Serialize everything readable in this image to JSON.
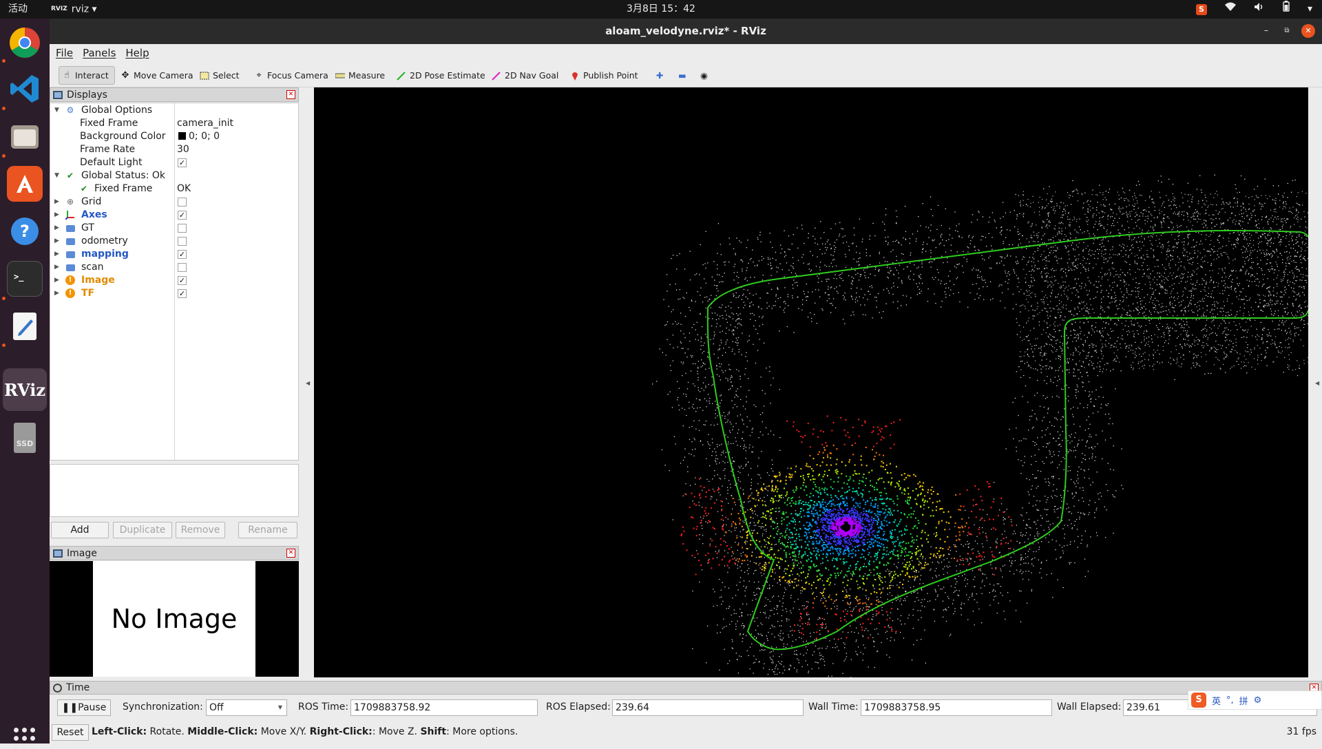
{
  "topbar": {
    "activities": "活动",
    "app_name": "rviz",
    "app_logo": "RVIZ",
    "clock": "3月8日  15：42"
  },
  "window": {
    "title": "aloam_velodyne.rviz* - RViz"
  },
  "menu": [
    "File",
    "Panels",
    "Help"
  ],
  "toolbar": [
    {
      "label": "Interact",
      "icon": "cursor-icon",
      "active": true
    },
    {
      "label": "Move Camera",
      "icon": "move-icon"
    },
    {
      "label": "Select",
      "icon": "select-box-icon"
    },
    {
      "label": "Focus Camera",
      "icon": "crosshair-icon"
    },
    {
      "label": "Measure",
      "icon": "ruler-icon"
    },
    {
      "label": "2D Pose Estimate",
      "icon": "green-arrow-icon"
    },
    {
      "label": "2D Nav Goal",
      "icon": "magenta-arrow-icon"
    },
    {
      "label": "Publish Point",
      "icon": "pin-icon"
    }
  ],
  "displays": {
    "title": "Displays",
    "global_options": "Global Options",
    "fixed_frame_label": "Fixed Frame",
    "fixed_frame_value": "camera_init",
    "bg_color_label": "Background Color",
    "bg_color_value": "0; 0; 0",
    "bg_color_swatch": "#000000",
    "frame_rate_label": "Frame Rate",
    "frame_rate_value": "30",
    "default_light_label": "Default Light",
    "global_status": "Global Status: Ok",
    "status_fixed_frame": "Fixed Frame",
    "status_fixed_frame_value": "OK",
    "items": [
      {
        "name": "Grid",
        "checked": false,
        "style": "normal",
        "icon": "grid-icon"
      },
      {
        "name": "Axes",
        "checked": true,
        "style": "blue",
        "icon": "axes-icon"
      },
      {
        "name": "GT",
        "checked": false,
        "style": "normal",
        "icon": "folder-icon"
      },
      {
        "name": "odometry",
        "checked": false,
        "style": "normal",
        "icon": "folder-icon"
      },
      {
        "name": "mapping",
        "checked": true,
        "style": "blue",
        "icon": "folder-icon"
      },
      {
        "name": "scan",
        "checked": false,
        "style": "normal",
        "icon": "folder-icon"
      },
      {
        "name": "Image",
        "checked": true,
        "style": "orange",
        "icon": "warning-icon"
      },
      {
        "name": "TF",
        "checked": true,
        "style": "orange",
        "icon": "warning-icon"
      }
    ],
    "buttons": {
      "add": "Add",
      "duplicate": "Duplicate",
      "remove": "Remove",
      "rename": "Rename"
    }
  },
  "image_panel": {
    "title": "Image",
    "placeholder": "No Image"
  },
  "time": {
    "title": "Time",
    "pause": "Pause",
    "sync_label": "Synchronization:",
    "sync_value": "Off",
    "ros_time_label": "ROS Time:",
    "ros_time": "1709883758.92",
    "ros_elapsed_label": "ROS Elapsed:",
    "ros_elapsed": "239.64",
    "wall_time_label": "Wall Time:",
    "wall_time": "1709883758.95",
    "wall_elapsed_label": "Wall Elapsed:",
    "wall_elapsed": "239.61"
  },
  "status": {
    "reset": "Reset",
    "left": "Left-Click:",
    "left_t": " Rotate. ",
    "middle": "Middle-Click:",
    "middle_t": " Move X/Y. ",
    "right": "Right-Click:",
    "right_t": ": Move Z. ",
    "shift": "Shift",
    "shift_t": ": More options.",
    "fps": "31 fps"
  },
  "ime": {
    "lang": "英",
    "pinyin": "拼"
  },
  "colors": {
    "trajectory": "#2ecc1e",
    "accent": "#e95420"
  }
}
